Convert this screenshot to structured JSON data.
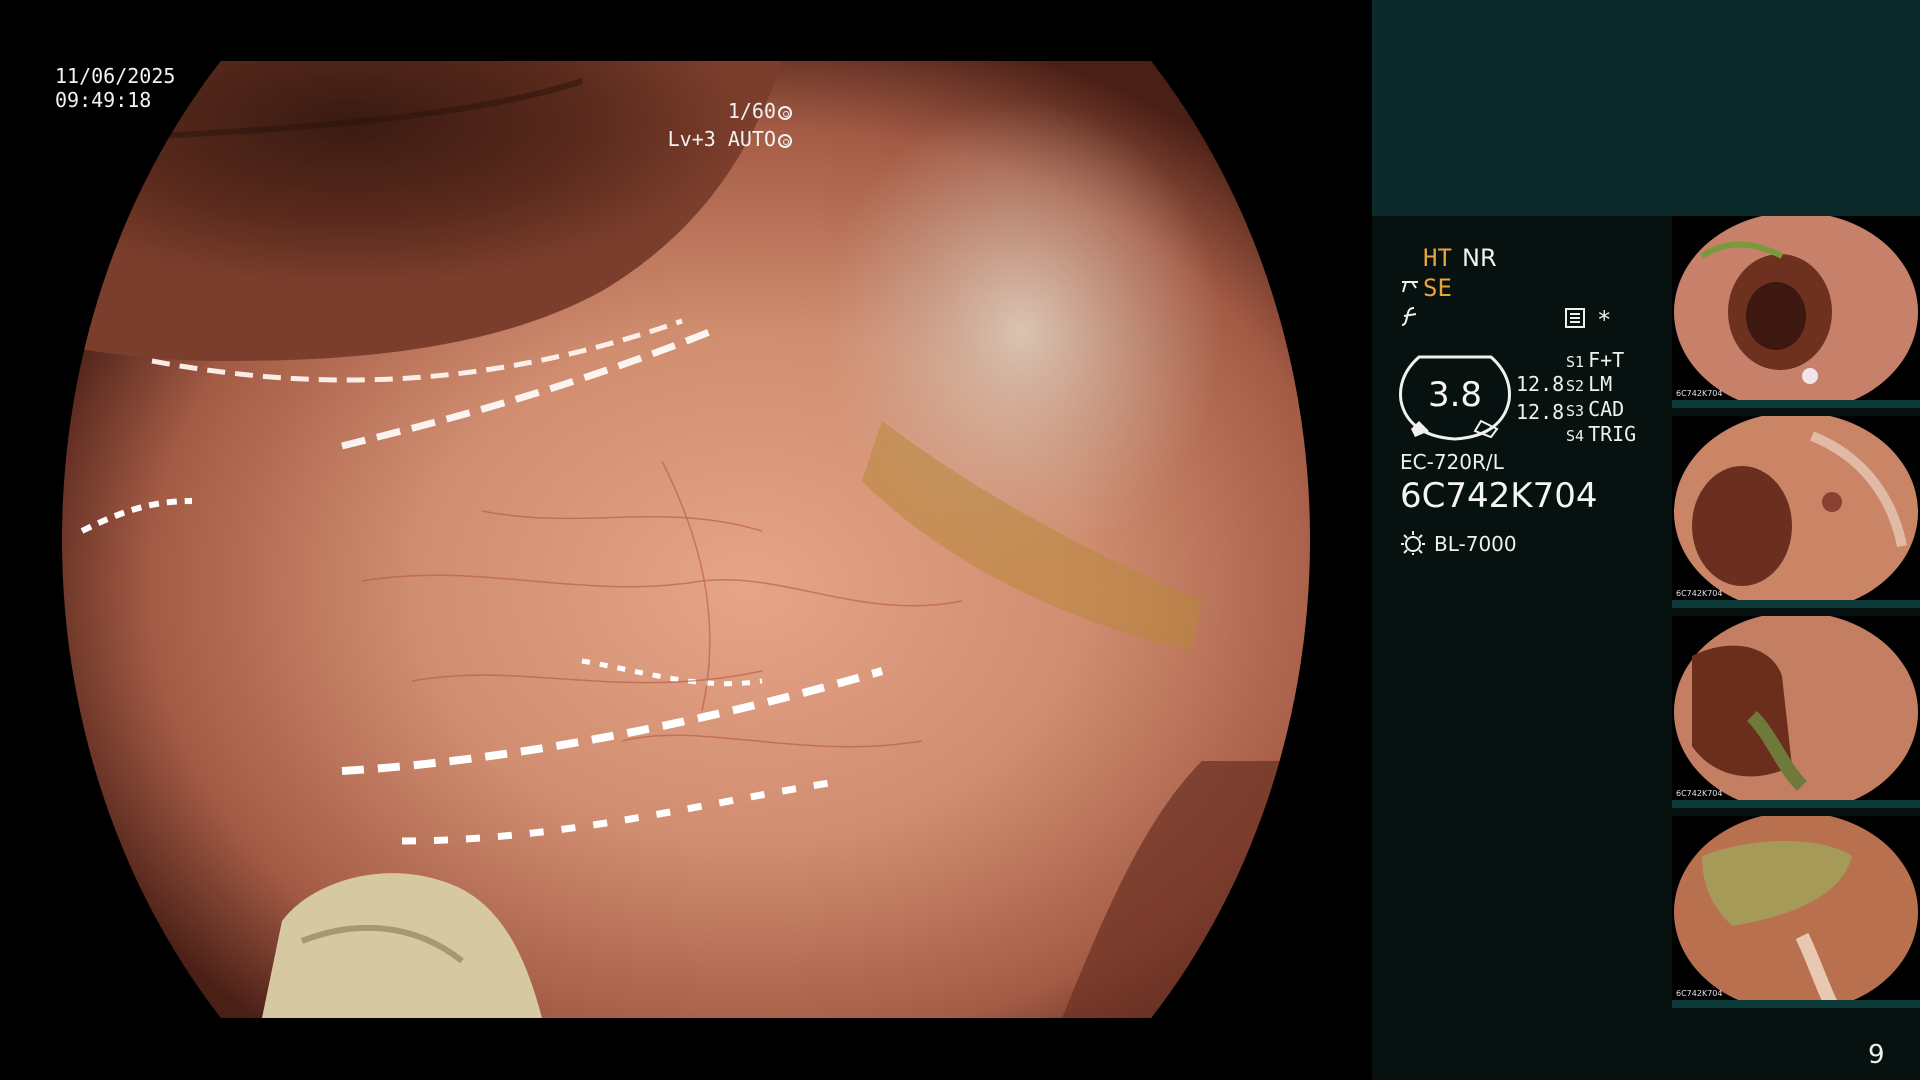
{
  "main_view": {
    "date": "11/06/2025",
    "time": "09:49:18",
    "shutter": "1/60",
    "level": "Lv+3 AUTO"
  },
  "panel": {
    "ht_label": "HT",
    "nr_label": "NR",
    "se_label": "SE",
    "star": "*",
    "gauge_value": "3.8",
    "value_1": "12.8",
    "value_2": "12.8",
    "switches": [
      {
        "key": "S1",
        "value": "F+T"
      },
      {
        "key": "S2",
        "value": "LM"
      },
      {
        "key": "S3",
        "value": "CAD"
      },
      {
        "key": "S4",
        "value": "TRIG"
      }
    ],
    "scope_model": "EC-720R/L",
    "scope_serial": "6C742K704",
    "light_source": "BL-7000",
    "page_number": "9"
  },
  "thumbnails": [
    {
      "serial": "6C742K704"
    },
    {
      "serial": "6C742K704"
    },
    {
      "serial": "6C742K704"
    },
    {
      "serial": "6C742K704"
    }
  ],
  "colors": {
    "highlight_orange": "#e8a33a",
    "panel_top": "#0c2a29",
    "panel_bg": "#061110",
    "mucosa": "#c9866a"
  },
  "icons": [
    "aperture-icon",
    "auto-iris-icon",
    "structure-enhance-icon",
    "color-enhance-icon",
    "memory-icon",
    "light-source-icon"
  ]
}
